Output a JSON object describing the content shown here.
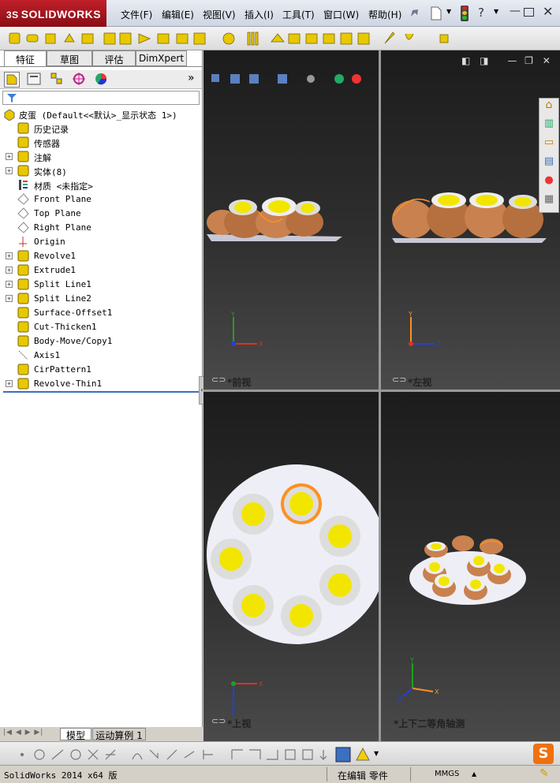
{
  "app": {
    "logo_text": "SOLIDWORKS",
    "brand_color": "#b0161e"
  },
  "menu": [
    "文件(F)",
    "编辑(E)",
    "视图(V)",
    "插入(I)",
    "工具(T)",
    "窗口(W)",
    "帮助(H)"
  ],
  "panel_tabs": [
    "特征",
    "草图",
    "评估",
    "DimXpert"
  ],
  "tree": {
    "root": "皮蛋  (Default<<默认>_显示状态 1>)",
    "items": [
      {
        "label": "历史记录",
        "expandable": false,
        "icon": "history-icon"
      },
      {
        "label": "传感器",
        "expandable": false,
        "icon": "sensor-icon"
      },
      {
        "label": "注解",
        "expandable": true,
        "icon": "annotation-icon"
      },
      {
        "label": "实体(8)",
        "expandable": true,
        "icon": "solid-bodies-icon"
      },
      {
        "label": "材质 <未指定>",
        "expandable": false,
        "icon": "material-icon"
      },
      {
        "label": "Front Plane",
        "expandable": false,
        "icon": "plane-icon"
      },
      {
        "label": "Top Plane",
        "expandable": false,
        "icon": "plane-icon"
      },
      {
        "label": "Right Plane",
        "expandable": false,
        "icon": "plane-icon"
      },
      {
        "label": "Origin",
        "expandable": false,
        "icon": "origin-icon"
      },
      {
        "label": "Revolve1",
        "expandable": true,
        "icon": "revolve-icon"
      },
      {
        "label": "Extrude1",
        "expandable": true,
        "icon": "extrude-icon"
      },
      {
        "label": "Split Line1",
        "expandable": true,
        "icon": "split-line-icon"
      },
      {
        "label": "Split Line2",
        "expandable": true,
        "icon": "split-line-icon"
      },
      {
        "label": "Surface-Offset1",
        "expandable": false,
        "icon": "surface-offset-icon"
      },
      {
        "label": "Cut-Thicken1",
        "expandable": false,
        "icon": "cut-thicken-icon"
      },
      {
        "label": "Body-Move/Copy1",
        "expandable": false,
        "icon": "body-move-icon"
      },
      {
        "label": "Axis1",
        "expandable": false,
        "icon": "axis-icon"
      },
      {
        "label": "CirPattern1",
        "expandable": false,
        "icon": "circular-pattern-icon"
      },
      {
        "label": "Revolve-Thin1",
        "expandable": true,
        "icon": "revolve-icon"
      }
    ]
  },
  "views": {
    "front": "*前视",
    "left": "*左视",
    "top": "*上视",
    "iso": "*上下二等角轴测"
  },
  "bottom_tabs": [
    "模型",
    "运动算例 1"
  ],
  "status": {
    "version": "SolidWorks 2014 x64 版",
    "mode": "在编辑 零件",
    "units": "MMGS"
  },
  "colors": {
    "yolk": "#f2e600",
    "shell": "#c9814f",
    "plate": "#e8e8f0",
    "axis_x": "#e03020",
    "axis_y": "#20a020",
    "axis_z": "#2040e0"
  }
}
